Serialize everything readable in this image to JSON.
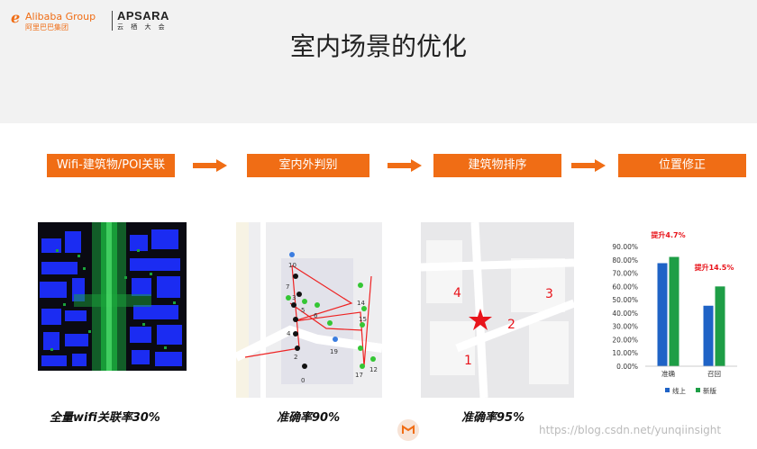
{
  "header": {
    "alibaba_logo_text": "Alibaba Group",
    "alibaba_logo_sub": "阿里巴巴集团",
    "apsara_logo_text": "APSARA",
    "apsara_logo_sub": "云 栖 大 会",
    "title": "室内场景的优化"
  },
  "steps": [
    {
      "label": "Wifi-建筑物/POI关联"
    },
    {
      "label": "室内外判别"
    },
    {
      "label": "建筑物排序"
    },
    {
      "label": "位置修正"
    }
  ],
  "captions": [
    "全量wifi关联率30%",
    "准确率90%",
    "准确率95%"
  ],
  "map2": {
    "point_labels": [
      "10",
      "7",
      "3",
      "5",
      "6",
      "4",
      "2",
      "0",
      "19",
      "17",
      "12",
      "14",
      "15"
    ]
  },
  "map3": {
    "rank_labels": [
      "4",
      "3",
      "2",
      "1"
    ]
  },
  "chart_data": {
    "type": "bar",
    "categories": [
      "准确",
      "召回"
    ],
    "series": [
      {
        "name": "线上",
        "values": [
          77.5,
          45.5
        ],
        "color": "#1f63c6"
      },
      {
        "name": "新版",
        "values": [
          82.2,
          60.0
        ],
        "color": "#1e9e46"
      }
    ],
    "ylim": [
      0,
      90
    ],
    "yticks": [
      "0.00%",
      "10.00%",
      "20.00%",
      "30.00%",
      "40.00%",
      "50.00%",
      "60.00%",
      "70.00%",
      "80.00%",
      "90.00%"
    ],
    "annotations": [
      "提升4.7%",
      "提升14.5%"
    ],
    "annotation_color": "#e8141b",
    "legend": "bottom"
  },
  "watermark": "https://blog.csdn.net/yunqiinsight",
  "colors": {
    "accent": "#f06d15",
    "header_bg": "#f2f2f2"
  }
}
